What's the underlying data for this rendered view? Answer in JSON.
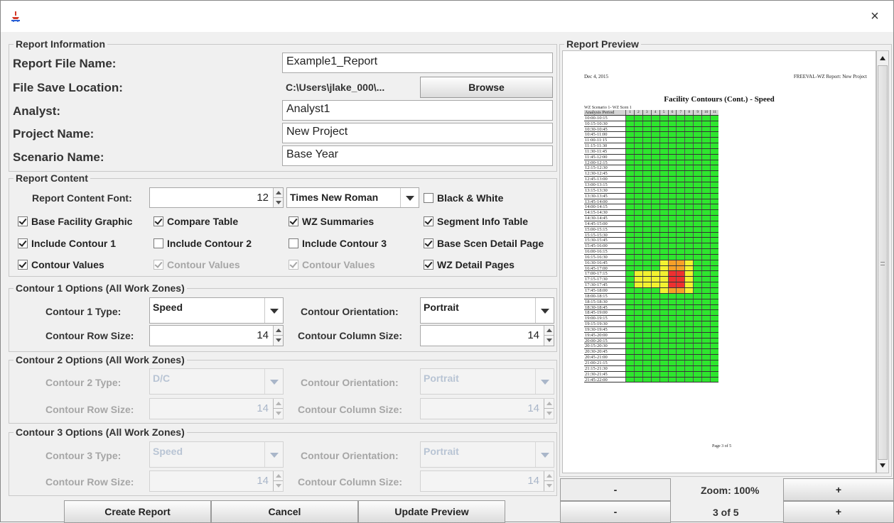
{
  "window": {
    "title": "",
    "close_label": "×"
  },
  "report_info": {
    "legend": "Report Information",
    "file_name_label": "Report File Name:",
    "file_name_value": "Example1_Report",
    "save_location_label": "File Save Location:",
    "save_location_value": "C:\\Users\\jlake_000\\...",
    "browse_label": "Browse",
    "analyst_label": "Analyst:",
    "analyst_value": "Analyst1",
    "project_label": "Project Name:",
    "project_value": "New Project",
    "scenario_label": "Scenario Name:",
    "scenario_value": "Base Year"
  },
  "report_content": {
    "legend": "Report Content",
    "font_label": "Report Content Font:",
    "font_size": "12",
    "font_name": "Times New Roman",
    "black_white": {
      "label": "Black & White",
      "checked": false
    },
    "row2": [
      {
        "label": "Base Facility Graphic",
        "checked": true
      },
      {
        "label": "Compare Table",
        "checked": true
      },
      {
        "label": "WZ Summaries",
        "checked": true
      },
      {
        "label": "Segment Info Table",
        "checked": true
      }
    ],
    "row3": [
      {
        "label": "Include Contour 1",
        "checked": true
      },
      {
        "label": "Include Contour 2",
        "checked": false
      },
      {
        "label": "Include Contour 3",
        "checked": false
      },
      {
        "label": "Base Scen Detail Page",
        "checked": true
      }
    ],
    "row4": [
      {
        "label": "Contour Values",
        "checked": true,
        "enabled": true
      },
      {
        "label": "Contour Values",
        "checked": true,
        "enabled": false
      },
      {
        "label": "Contour Values",
        "checked": true,
        "enabled": false
      },
      {
        "label": "WZ Detail Pages",
        "checked": true,
        "enabled": true
      }
    ]
  },
  "contour1": {
    "legend": "Contour 1 Options (All Work Zones)",
    "type_label": "Contour 1 Type:",
    "type_value": "Speed",
    "orient_label": "Contour Orientation:",
    "orient_value": "Portrait",
    "row_label": "Contour Row Size:",
    "row_value": "14",
    "col_label": "Contour Column Size:",
    "col_value": "14"
  },
  "contour2": {
    "legend": "Contour 2 Options (All Work Zones)",
    "type_label": "Contour 2 Type:",
    "type_value": "D/C",
    "orient_label": "Contour Orientation:",
    "orient_value": "Portrait",
    "row_label": "Contour Row Size:",
    "row_value": "14",
    "col_label": "Contour Column Size:",
    "col_value": "14"
  },
  "contour3": {
    "legend": "Contour 3 Options (All Work Zones)",
    "type_label": "Contour 3 Type:",
    "type_value": "Speed",
    "orient_label": "Contour Orientation:",
    "orient_value": "Portrait",
    "row_label": "Contour Row Size:",
    "row_value": "14",
    "col_label": "Contour Column Size:",
    "col_value": "14"
  },
  "actions": {
    "create": "Create Report",
    "cancel": "Cancel",
    "update": "Update Preview"
  },
  "preview": {
    "legend": "Report Preview",
    "date": "Dec 4, 2015",
    "header_right": "FREEVAL-WZ Report: New Project",
    "title": "Facility Contours (Cont.) - Speed",
    "scenario": "WZ Scenario 1- WZ Scen 1",
    "column_header": "Analysis Period",
    "segments": [
      "1",
      "2",
      "3",
      "4",
      "5",
      "6",
      "7",
      "8",
      "9",
      "10",
      "11"
    ],
    "periods": [
      "10:00-10:15",
      "10:15-10:30",
      "10:30-10:45",
      "10:45-11:00",
      "11:00-11:15",
      "11:15-11:30",
      "11:30-11:45",
      "11:45-12:00",
      "12:00-12:15",
      "12:15-12:30",
      "12:30-12:45",
      "12:45-13:00",
      "13:00-13:15",
      "13:15-13:30",
      "13:30-13:45",
      "13:45-14:00",
      "14:00-14:15",
      "14:15-14:30",
      "14:30-14:45",
      "14:45-15:00",
      "15:00-15:15",
      "15:15-15:30",
      "15:30-15:45",
      "15:45-16:00",
      "16:00-16:15",
      "16:15-16:30",
      "16:30-16:45",
      "16:45-17:00",
      "17:00-17:15",
      "17:15-17:30",
      "17:30-17:45",
      "17:45-18:00",
      "18:00-18:15",
      "18:15-18:30",
      "18:30-18:45",
      "18:45-19:00",
      "19:00-19:15",
      "19:15-19:30",
      "19:30-19:45",
      "19:45-20:00",
      "20:00-20:15",
      "20:15-20:30",
      "20:30-20:45",
      "20:45-21:00",
      "21:00-21:15",
      "21:15-21:30",
      "21:30-21:45",
      "21:45-22:00"
    ],
    "page_footer": "Page 3 of 5",
    "colors": {
      "green": "#2ee62e",
      "yellow": "#f2f230",
      "orange": "#f7a028",
      "red": "#ee3030",
      "header": "#d4d4d4"
    }
  },
  "zoom": {
    "out_label": "-",
    "display": "Zoom: 100%",
    "in_label": "+"
  },
  "pager": {
    "prev_label": "-",
    "display": "3 of 5",
    "next_label": "+"
  }
}
